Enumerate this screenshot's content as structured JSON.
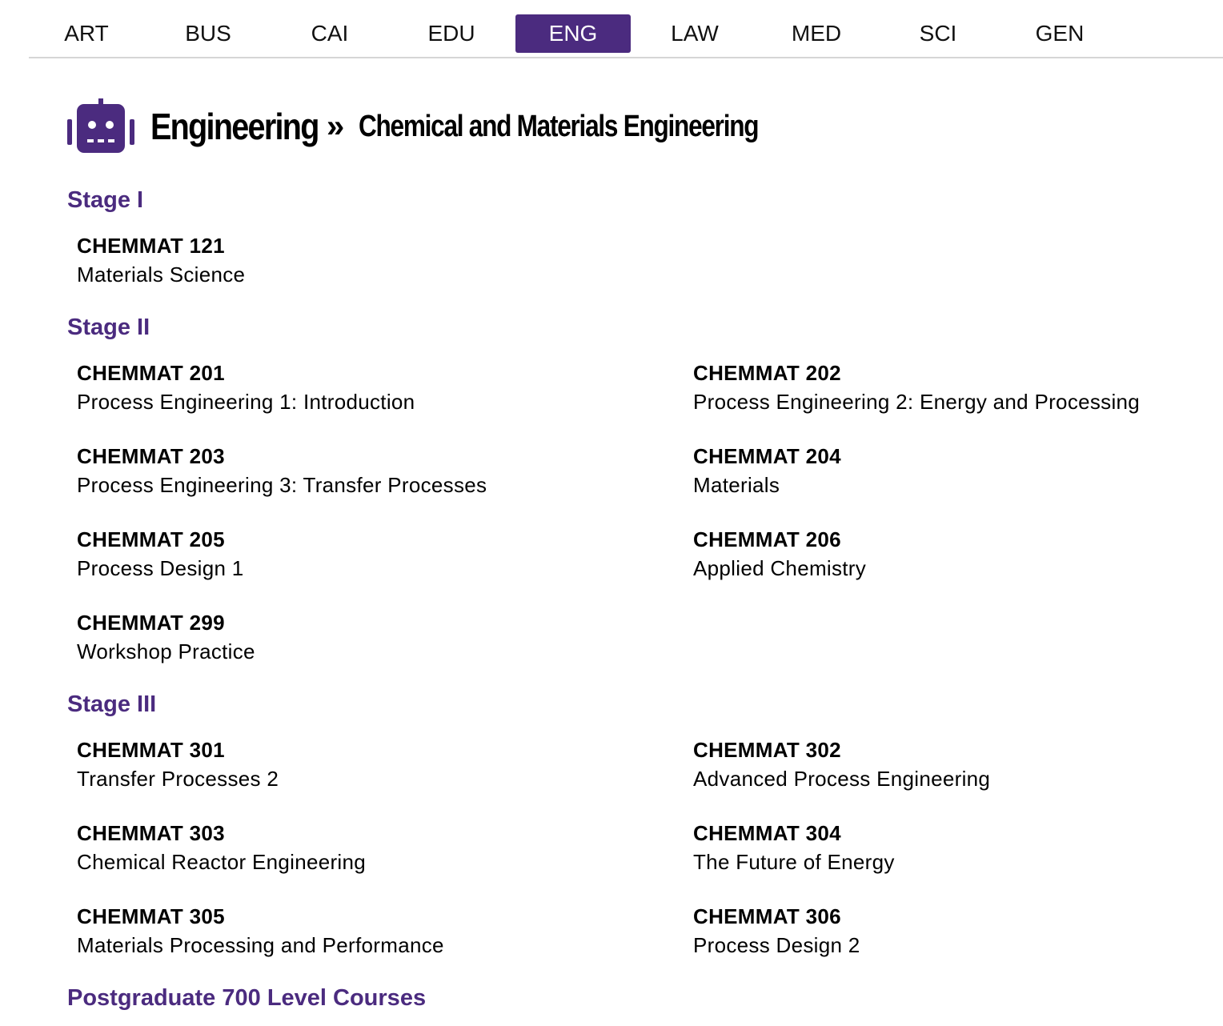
{
  "nav": {
    "tabs": [
      {
        "label": "ART",
        "active": false
      },
      {
        "label": "BUS",
        "active": false
      },
      {
        "label": "CAI",
        "active": false
      },
      {
        "label": "EDU",
        "active": false
      },
      {
        "label": "ENG",
        "active": true
      },
      {
        "label": "LAW",
        "active": false
      },
      {
        "label": "MED",
        "active": false
      },
      {
        "label": "SCI",
        "active": false
      },
      {
        "label": "GEN",
        "active": false
      }
    ],
    "active_color": "#4b2b7f"
  },
  "header": {
    "icon": "robot-icon",
    "faculty": "Engineering",
    "separator": "»",
    "department": "Chemical and Materials Engineering"
  },
  "accent_color": "#4b2b7f",
  "stages": [
    {
      "title": "Stage I",
      "courses": [
        {
          "code": "CHEMMAT 121",
          "name": "Materials Science"
        }
      ]
    },
    {
      "title": "Stage II",
      "courses": [
        {
          "code": "CHEMMAT 201",
          "name": "Process Engineering 1: Introduction"
        },
        {
          "code": "CHEMMAT 202",
          "name": "Process Engineering 2: Energy and Processing"
        },
        {
          "code": "CHEMMAT 203",
          "name": "Process Engineering 3: Transfer Processes"
        },
        {
          "code": "CHEMMAT 204",
          "name": "Materials"
        },
        {
          "code": "CHEMMAT 205",
          "name": "Process Design 1"
        },
        {
          "code": "CHEMMAT 206",
          "name": "Applied Chemistry"
        },
        {
          "code": "CHEMMAT 299",
          "name": "Workshop Practice"
        }
      ]
    },
    {
      "title": "Stage III",
      "courses": [
        {
          "code": "CHEMMAT 301",
          "name": "Transfer Processes 2"
        },
        {
          "code": "CHEMMAT 302",
          "name": "Advanced Process Engineering"
        },
        {
          "code": "CHEMMAT 303",
          "name": "Chemical Reactor Engineering"
        },
        {
          "code": "CHEMMAT 304",
          "name": "The Future of Energy"
        },
        {
          "code": "CHEMMAT 305",
          "name": "Materials Processing and Performance"
        },
        {
          "code": "CHEMMAT 306",
          "name": "Process Design 2"
        }
      ]
    },
    {
      "title": "Postgraduate 700 Level Courses",
      "courses": []
    }
  ]
}
